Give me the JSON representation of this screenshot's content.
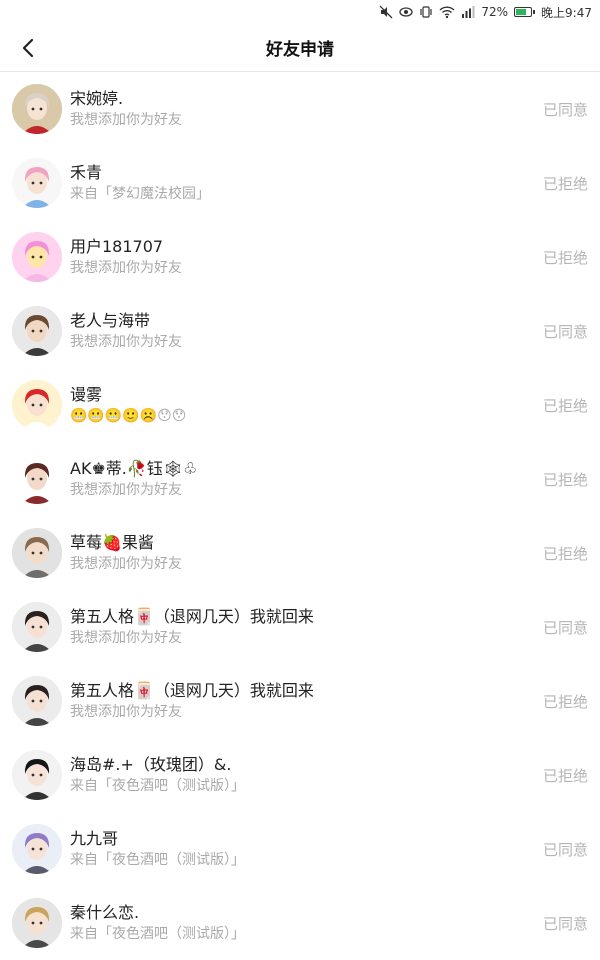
{
  "status_bar": {
    "battery_text": "72%",
    "time": "晚上9:47",
    "icons": [
      "mute-icon",
      "eye-icon",
      "vibrate-icon",
      "wifi-icon",
      "signal-icon",
      "battery-icon"
    ]
  },
  "header": {
    "title": "好友申请",
    "back_icon": "chevron-left-icon"
  },
  "requests": [
    {
      "name": "宋婉婷.",
      "message": "我想添加你为好友",
      "status": "已同意",
      "avatar_bg": "#d9c9a8",
      "avatar_hair": "#d8d2c8",
      "avatar_skin": "#f6e3d3",
      "avatar_cloth": "#c0262e"
    },
    {
      "name": "禾青",
      "message": "来自「梦幻魔法校园」",
      "status": "已拒绝",
      "avatar_bg": "#f7f7f7",
      "avatar_hair": "#f2a3c4",
      "avatar_skin": "#f8e0d3",
      "avatar_cloth": "#7fb2e6"
    },
    {
      "name": "用户181707",
      "message": "我想添加你为好友",
      "status": "已拒绝",
      "avatar_bg": "#ffd3f0",
      "avatar_hair": "#f38ed8",
      "avatar_skin": "#ffe6a8",
      "avatar_cloth": "#f6b8e6"
    },
    {
      "name": "老人与海带",
      "message": "我想添加你为好友",
      "status": "已同意",
      "avatar_bg": "#e8e8e8",
      "avatar_hair": "#6a4a32",
      "avatar_skin": "#f2d7c2",
      "avatar_cloth": "#3b3b3b"
    },
    {
      "name": "谩雾",
      "message": "😬😬😬🙂☹️😯😯",
      "status": "已拒绝",
      "avatar_bg": "#fff3cf",
      "avatar_hair": "#d82727",
      "avatar_skin": "#f8e1d0",
      "avatar_cloth": "#ffffff"
    },
    {
      "name": "AK♚蒂.🥀钰🕸♧",
      "message": "我想添加你为好友",
      "status": "已拒绝",
      "avatar_bg": "#ffffff",
      "avatar_hair": "#5a2a22",
      "avatar_skin": "#f4d9c9",
      "avatar_cloth": "#8a2a2a"
    },
    {
      "name": "草莓🍓果酱",
      "message": "我想添加你为好友",
      "status": "已拒绝",
      "avatar_bg": "#e2e2e2",
      "avatar_hair": "#8a6a4f",
      "avatar_skin": "#f4dccb",
      "avatar_cloth": "#6e6e6e"
    },
    {
      "name": "第五人格🀄（退网几天）我就回来",
      "message": "我想添加你为好友",
      "status": "已同意",
      "avatar_bg": "#ececec",
      "avatar_hair": "#2a2020",
      "avatar_skin": "#f6e0d4",
      "avatar_cloth": "#444444"
    },
    {
      "name": "第五人格🀄（退网几天）我就回来",
      "message": "我想添加你为好友",
      "status": "已拒绝",
      "avatar_bg": "#ececec",
      "avatar_hair": "#2a2020",
      "avatar_skin": "#f6e0d4",
      "avatar_cloth": "#444444"
    },
    {
      "name": "海岛#.+（玫瑰团）&.",
      "message": "来自「夜色酒吧（测试版）」",
      "status": "已拒绝",
      "avatar_bg": "#f2f2f2",
      "avatar_hair": "#151515",
      "avatar_skin": "#f6e2d6",
      "avatar_cloth": "#333333"
    },
    {
      "name": "九九哥",
      "message": "来自「夜色酒吧（测试版）」",
      "status": "已同意",
      "avatar_bg": "#e9eef7",
      "avatar_hair": "#8e7cc9",
      "avatar_skin": "#f6e2d6",
      "avatar_cloth": "#5a5a6e"
    },
    {
      "name": "秦什么恋.",
      "message": "来自「夜色酒吧（测试版）」",
      "status": "已同意",
      "avatar_bg": "#e5e5e5",
      "avatar_hair": "#c9a45a",
      "avatar_skin": "#f6e0d0",
      "avatar_cloth": "#4a4a4a"
    }
  ]
}
